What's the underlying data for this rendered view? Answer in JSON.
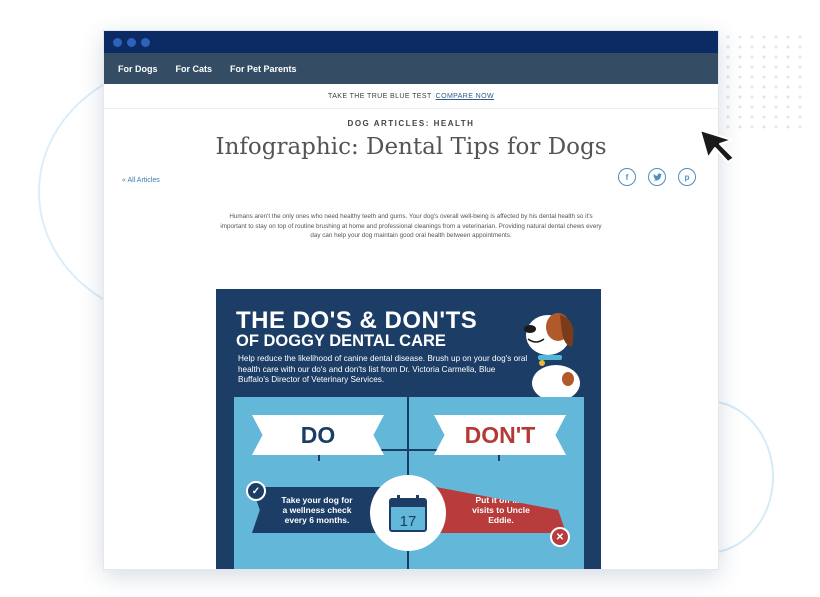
{
  "window": {
    "dots": 3
  },
  "nav": {
    "items": [
      "For Dogs",
      "For Cats",
      "For Pet Parents"
    ]
  },
  "promo": {
    "text": "TAKE THE TRUE BLUE TEST",
    "link": "COMPARE NOW"
  },
  "article": {
    "category": "DOG ARTICLES: HEALTH",
    "title": "Infographic: Dental Tips for Dogs",
    "back_link": "« All Articles",
    "share_icons": [
      "facebook-icon",
      "twitter-icon",
      "pinterest-icon"
    ],
    "intro": "Humans aren't the only ones who need healthy teeth and gums. Your dog's overall well-being is affected by his dental health so it's important to stay on top of routine brushing at home and professional cleanings from a veterinarian. Providing natural dental chews every day can help your dog maintain good oral health between appointments."
  },
  "infographic": {
    "heading1": "THE DO'S & DON'TS",
    "heading2": "OF DOGGY DENTAL CARE",
    "description": "Help reduce the likelihood of canine dental disease. Brush up on your dog's oral health care with our do's and don'ts list from Dr. Victoria Carmella, Blue Buffalo's Director of Veterinary Services.",
    "do_label": "DO",
    "dont_label": "DON'T",
    "do_tip": "Take your dog for a wellness check every 6 months.",
    "dont_tip": "Put it off like visits to Uncle Eddie.",
    "calendar_day": "17",
    "colors": {
      "navy": "#1b3d66",
      "panel": "#63b8d9",
      "red": "#b83c3c"
    }
  }
}
